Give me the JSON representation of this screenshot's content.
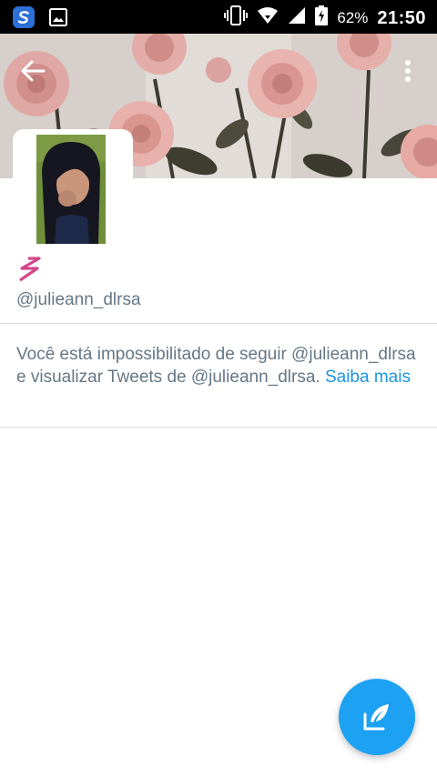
{
  "status_bar": {
    "battery_percent": "62%",
    "time": "21:50",
    "icons": [
      "swype-icon",
      "gallery-icon",
      "vibrate-icon",
      "wifi-icon",
      "signal-icon",
      "battery-charging-icon"
    ]
  },
  "header": {
    "back_icon": "arrow-left-icon",
    "more_icon": "more-vert-icon"
  },
  "profile": {
    "handle": "@julieann_dlrsa",
    "badge_icon": "zigzag-emoji-icon"
  },
  "blocked_notice": {
    "text": "Você está impossibilitado de seguir @julieann_dlrsa e visualizar Tweets de @julieann_dlrsa.",
    "link_text": "Saiba mais"
  },
  "fab": {
    "icon": "compose-tweet-icon"
  },
  "colors": {
    "accent": "#1da1f2",
    "link": "#1b95e0",
    "secondary_text": "#657786",
    "divider": "#d8dde1"
  }
}
